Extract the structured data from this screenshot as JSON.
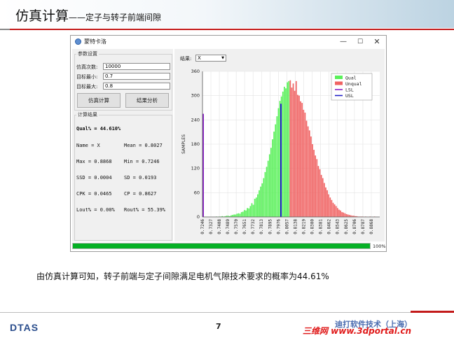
{
  "slide": {
    "title_main": "仿真计算",
    "title_sub": "——定子与转子前端间隙",
    "conclusion": "由仿真计算可知，转子前端与定子间隙满足电机气隙技术要求的概率为44.61%",
    "page_number": "7",
    "logo_text": "DTAS",
    "company_text": "迪打软件技术（上海）",
    "watermark_text": "三维网 www.3dportal.cn",
    "accent_red": "#c31a1a"
  },
  "window": {
    "title": "蒙特卡洛",
    "minimize_symbol": "—",
    "maximize_symbol": "☐",
    "close_symbol": "✕"
  },
  "params": {
    "group_title": "参数设置",
    "fields": [
      {
        "label": "仿真次数:",
        "value": "10000"
      },
      {
        "label": "目标最小:",
        "value": "0.7"
      },
      {
        "label": "目标最大:",
        "value": "0.8"
      }
    ],
    "simulate_button": "仿真计算",
    "analyze_button": "结果分析"
  },
  "results": {
    "group_title": "计算结果",
    "qual": "Qual% = 44.610%",
    "rows": [
      [
        "Name  = X",
        "Mean  = 0.8027"
      ],
      [
        "Max   = 0.8868",
        "Min   = 0.7246"
      ],
      [
        "SSD   = 0.0004",
        "SD    = 0.0193"
      ],
      [
        "CPK   = 0.0465",
        "CP    = 0.8627"
      ],
      [
        "Lout% = 0.00%",
        "Rout% = 55.39%"
      ]
    ]
  },
  "result_select": {
    "label": "结果:",
    "value": "X",
    "arrow": "▼"
  },
  "progress": {
    "value": 100,
    "text": "100%",
    "color": "#06b025"
  },
  "chart_data": {
    "type": "bar",
    "ylabel": "SAMPLES",
    "ylim": [
      0,
      360
    ],
    "yticks": [
      0,
      60,
      120,
      180,
      240,
      300,
      360
    ],
    "x_range": [
      0.7246,
      0.8949
    ],
    "x_tick_labels": [
      "0.7246",
      "0.7327",
      "0.7408",
      "0.7489",
      "0.7570",
      "0.7651",
      "0.7732",
      "0.7813",
      "0.7895",
      "0.7976",
      "0.8057",
      "0.8138",
      "0.8219",
      "0.8300",
      "0.8381",
      "0.8462",
      "0.8543",
      "0.8625",
      "0.8706",
      "0.8787",
      "0.8868"
    ],
    "lsl": 0.7246,
    "usl": 0.8,
    "lsl_height": 255,
    "usl_height": 280,
    "bin_width": 0.00142,
    "bins_x_start": 0.7246,
    "qual_counts": [
      1,
      0,
      0,
      0,
      0,
      0,
      0,
      0,
      0,
      1,
      0,
      1,
      1,
      2,
      1,
      2,
      3,
      3,
      2,
      4,
      5,
      6,
      6,
      8,
      9,
      8,
      12,
      13,
      17,
      16,
      22,
      21,
      27,
      34,
      30,
      45,
      48,
      56,
      66,
      75,
      83,
      96,
      111,
      124,
      139,
      155,
      171,
      192,
      211,
      229,
      249,
      269,
      287,
      298,
      310,
      322,
      318,
      333,
      336
    ],
    "unqual_counts": [
      338,
      320,
      330,
      312,
      336,
      302,
      300,
      286,
      282,
      265,
      258,
      238,
      224,
      214,
      199,
      180,
      166,
      152,
      143,
      126,
      118,
      104,
      96,
      84,
      73,
      66,
      56,
      48,
      42,
      35,
      31,
      27,
      22,
      18,
      16,
      12,
      11,
      9,
      7,
      6,
      5,
      4,
      3,
      3,
      2,
      2,
      1,
      1,
      1,
      1,
      0,
      1,
      0,
      0,
      1,
      0,
      0,
      1
    ],
    "legend": [
      {
        "name": "Qual",
        "kind": "box",
        "color": "#5af05a"
      },
      {
        "name": "Unqual",
        "kind": "box",
        "color": "#f06262"
      },
      {
        "name": "LSL",
        "kind": "line",
        "color": "#8a20c8"
      },
      {
        "name": "USL",
        "kind": "line",
        "color": "#2020c8"
      }
    ],
    "legend_position": "top-right",
    "grid": true
  }
}
